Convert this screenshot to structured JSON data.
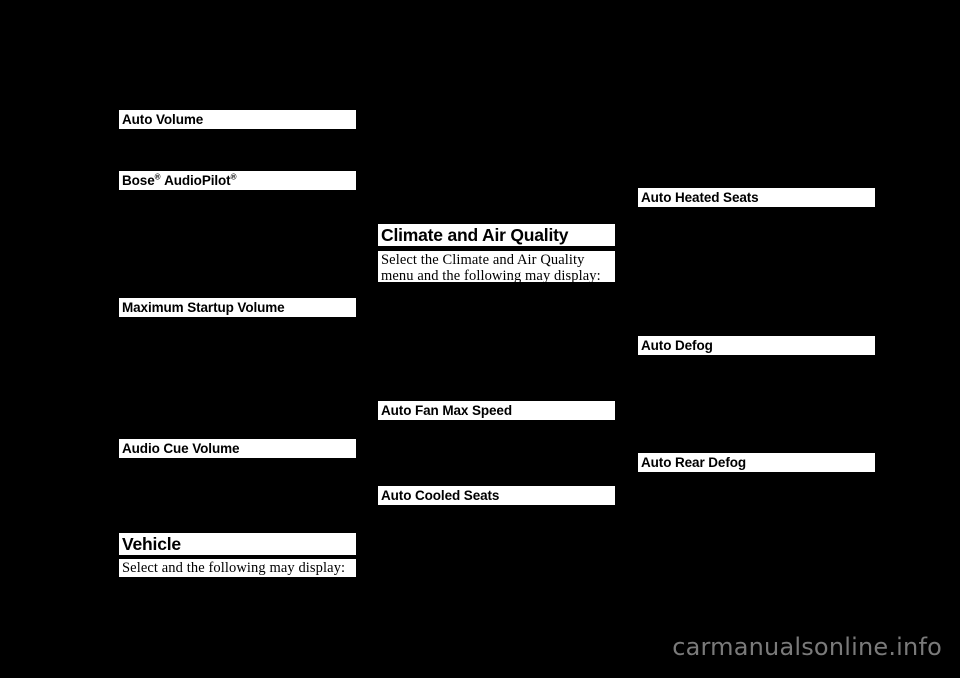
{
  "page": {
    "background_color": "#000000",
    "redaction_color": "#ffffff",
    "text_color": "#000000",
    "watermark": "carmanualsonline.info",
    "watermark_color": "#7a7a7a"
  },
  "columns": {
    "left": {
      "items": [
        {
          "id": "auto-volume",
          "label": "Auto Volume",
          "type": "subhead"
        },
        {
          "id": "bose-audiopilot",
          "label": "Bose",
          "label2": "AudioPilot",
          "trademark": "®",
          "type": "subhead-trademark"
        },
        {
          "id": "maximum-startup-volume",
          "label": "Maximum Startup Volume",
          "type": "subhead"
        },
        {
          "id": "audio-cue-volume",
          "label": "Audio Cue Volume",
          "type": "subhead"
        },
        {
          "id": "vehicle",
          "label": "Vehicle",
          "type": "section-head"
        },
        {
          "id": "vehicle-intro",
          "label": "Select and the following may display:",
          "type": "body"
        }
      ]
    },
    "middle": {
      "items": [
        {
          "id": "climate-and-air-quality",
          "label": "Climate and Air Quality",
          "type": "section-head"
        },
        {
          "id": "climate-intro",
          "line1": "Select the Climate and Air Quality",
          "line2": "menu and the following may display:",
          "type": "body"
        },
        {
          "id": "auto-fan-max-speed",
          "label": "Auto Fan Max Speed",
          "type": "subhead"
        },
        {
          "id": "auto-cooled-seats",
          "label": "Auto Cooled Seats",
          "type": "subhead"
        }
      ]
    },
    "right": {
      "items": [
        {
          "id": "auto-heated-seats",
          "label": "Auto Heated Seats",
          "type": "subhead"
        },
        {
          "id": "auto-defog",
          "label": "Auto Defog",
          "type": "subhead"
        },
        {
          "id": "auto-rear-defog",
          "label": "Auto Rear Defog",
          "type": "subhead"
        }
      ]
    }
  }
}
